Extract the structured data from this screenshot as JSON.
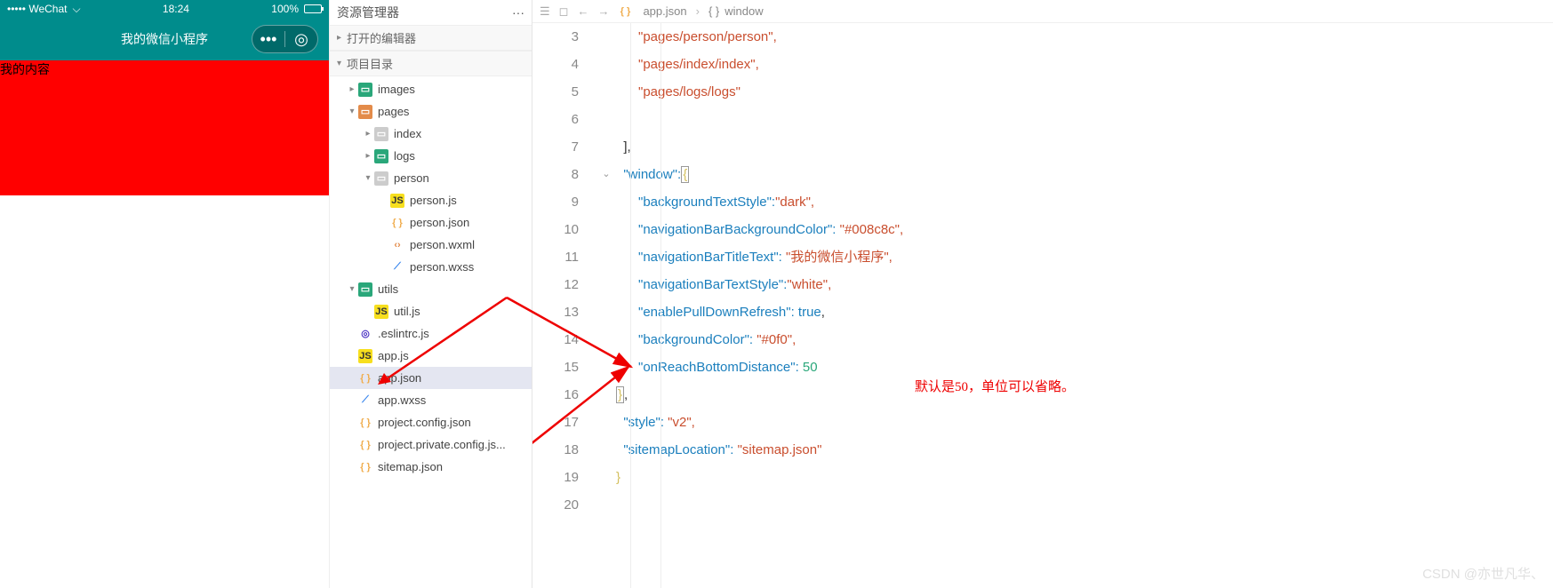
{
  "simulator": {
    "status_left": "••••• WeChat",
    "status_time": "18:24",
    "status_batt": "100%",
    "nav_title": "我的微信小程序",
    "page_text": "我的内容",
    "wifi_icon": "wifi",
    "capsule_dots": "•••",
    "capsule_target": "◎"
  },
  "explorer": {
    "title": "资源管理器",
    "more": "···",
    "sections": {
      "open_editors": "打开的编辑器",
      "project_dir": "项目目录"
    },
    "tree": {
      "images": "images",
      "pages": "pages",
      "index": "index",
      "logs": "logs",
      "person": "person",
      "person_js": "person.js",
      "person_json": "person.json",
      "person_wxml": "person.wxml",
      "person_wxss": "person.wxss",
      "utils": "utils",
      "util_js": "util.js",
      "eslintrc": ".eslintrc.js",
      "app_js": "app.js",
      "app_json": "app.json",
      "app_wxss": "app.wxss",
      "project_config": "project.config.json",
      "project_private": "project.private.config.js...",
      "sitemap": "sitemap.json"
    }
  },
  "breadcrumb": {
    "file": "app.json",
    "segment": "window"
  },
  "code": {
    "l3": "      \"pages/person/person\",",
    "l4": "      \"pages/index/index\",",
    "l5": "      \"pages/logs/logs\"",
    "l6": "",
    "l7": "  ],",
    "l8a": "  \"window\":",
    "l8b": "{",
    "l9a": "      \"backgroundTextStyle\":",
    "l9b": "\"dark\",",
    "l10a": "      \"navigationBarBackgroundColor\": ",
    "l10b": "\"#008c8c\",",
    "l11a": "      \"navigationBarTitleText\": ",
    "l11b": "\"我的微信小程序\",",
    "l12a": "      \"navigationBarTextStyle\":",
    "l12b": "\"white\",",
    "l13a": "      \"enablePullDownRefresh\": ",
    "l13b": "true",
    "l14a": "      \"backgroundColor\": ",
    "l14b": "\"#0f0\",",
    "l15a": "      \"onReachBottomDistance\": ",
    "l15b": "50",
    "l16": "  },",
    "l17a": "  \"style\": ",
    "l17b": "\"v2\",",
    "l18a": "  \"sitemapLocation\": ",
    "l18b": "\"sitemap.json\"",
    "l19": "}",
    "l20": ""
  },
  "line_numbers": [
    "3",
    "4",
    "5",
    "6",
    "7",
    "8",
    "9",
    "10",
    "11",
    "12",
    "13",
    "14",
    "15",
    "16",
    "17",
    "18",
    "19",
    "20"
  ],
  "annotation": "默认是50，单位可以省略。",
  "watermark": "CSDN @亦世凡华、"
}
